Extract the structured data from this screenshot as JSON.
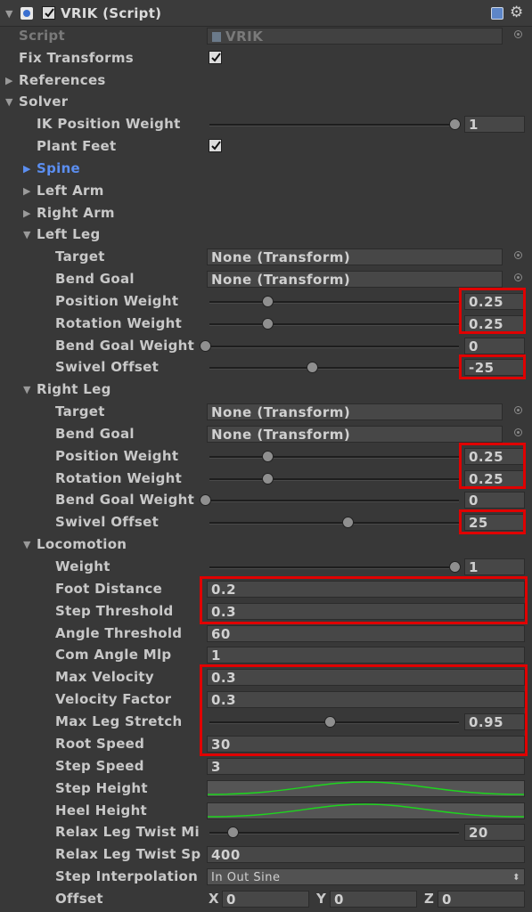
{
  "header": {
    "title": "VRIK (Script)"
  },
  "script_row": {
    "label": "Script",
    "value": "VRIK"
  },
  "fix_transforms": {
    "label": "Fix Transforms"
  },
  "references": {
    "label": "References"
  },
  "solver": {
    "label": "Solver",
    "ik_position_weight": {
      "label": "IK Position Weight",
      "value": "1",
      "level": 1.0
    },
    "plant_feet": {
      "label": "Plant Feet"
    },
    "spine": {
      "label": "Spine"
    },
    "left_arm": {
      "label": "Left Arm"
    },
    "right_arm": {
      "label": "Right Arm"
    }
  },
  "left_leg": {
    "label": "Left Leg",
    "target": {
      "label": "Target",
      "value": "None (Transform)"
    },
    "bend_goal": {
      "label": "Bend Goal",
      "value": "None (Transform)"
    },
    "position_weight": {
      "label": "Position Weight",
      "value": "0.25",
      "level": 0.25
    },
    "rotation_weight": {
      "label": "Rotation Weight",
      "value": "0.25",
      "level": 0.25
    },
    "bend_goal_weight": {
      "label": "Bend Goal Weight",
      "value": "0",
      "level": 0
    },
    "swivel_offset": {
      "label": "Swivel Offset",
      "value": "-25",
      "level": 0.43
    }
  },
  "right_leg": {
    "label": "Right Leg",
    "target": {
      "label": "Target",
      "value": "None (Transform)"
    },
    "bend_goal": {
      "label": "Bend Goal",
      "value": "None (Transform)"
    },
    "position_weight": {
      "label": "Position Weight",
      "value": "0.25",
      "level": 0.25
    },
    "rotation_weight": {
      "label": "Rotation Weight",
      "value": "0.25",
      "level": 0.25
    },
    "bend_goal_weight": {
      "label": "Bend Goal Weight",
      "value": "0",
      "level": 0
    },
    "swivel_offset": {
      "label": "Swivel Offset",
      "value": "25",
      "level": 0.57
    }
  },
  "locomotion": {
    "label": "Locomotion",
    "weight": {
      "label": "Weight",
      "value": "1",
      "level": 1.0
    },
    "foot_distance": {
      "label": "Foot Distance",
      "value": "0.2"
    },
    "step_threshold": {
      "label": "Step Threshold",
      "value": "0.3"
    },
    "angle_threshold": {
      "label": "Angle Threshold",
      "value": "60"
    },
    "com_angle_mlp": {
      "label": "Com Angle Mlp",
      "value": "1"
    },
    "max_velocity": {
      "label": "Max Velocity",
      "value": "0.3"
    },
    "velocity_factor": {
      "label": "Velocity Factor",
      "value": "0.3"
    },
    "max_leg_stretch": {
      "label": "Max Leg Stretch",
      "value": "0.95",
      "level": 0.5
    },
    "root_speed": {
      "label": "Root Speed",
      "value": "30"
    },
    "step_speed": {
      "label": "Step Speed",
      "value": "3"
    },
    "step_height": {
      "label": "Step Height"
    },
    "heel_height": {
      "label": "Heel Height"
    },
    "relax_leg_twist_min": {
      "label": "Relax Leg Twist Mi",
      "value": "20",
      "level": 0.11
    },
    "relax_leg_twist_speed": {
      "label": "Relax Leg Twist Sp",
      "value": "400"
    },
    "step_interpolation": {
      "label": "Step Interpolation",
      "value": "In Out Sine"
    },
    "offset": {
      "label": "Offset",
      "x_label": "X",
      "x": "0",
      "y_label": "Y",
      "y": "0",
      "z_label": "Z",
      "z": "0"
    }
  },
  "colors": {
    "highlight": "#e00000",
    "accent_blue": "#5b8ef0",
    "curve": "#1ed41e"
  },
  "icons": [
    "expand-arrow-icon",
    "script-file-icon",
    "help-book-icon",
    "gear-icon",
    "object-picker-icon",
    "checkmark-icon"
  ]
}
